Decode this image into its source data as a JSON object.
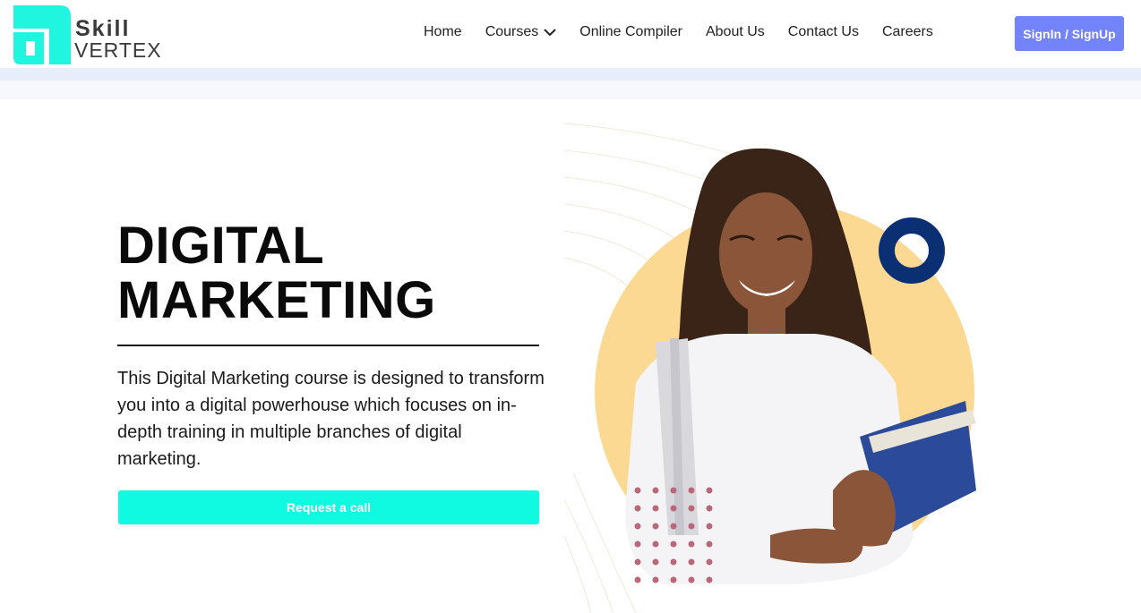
{
  "logo": {
    "line1": "Skill",
    "line2": "VERTEX",
    "mark_color": "#1ff5df"
  },
  "nav": {
    "items": [
      {
        "label": "Home"
      },
      {
        "label": "Courses"
      },
      {
        "label": "Online Compiler"
      },
      {
        "label": "About Us"
      },
      {
        "label": "Contact Us"
      },
      {
        "label": "Careers"
      }
    ],
    "signin_label": "SignIn / SignUp"
  },
  "hero": {
    "title_line1": "DIGITAL",
    "title_line2": "MARKETING",
    "description": "This Digital Marketing course is designed to transform you into a digital powerhouse which focuses on in-depth training in multiple branches of digital marketing.",
    "cta_label": "Request a call"
  },
  "colors": {
    "accent": "#10fae2",
    "signin": "#7383f9",
    "circle": "#fcd993",
    "ring": "#0b2f73",
    "dots": "#b8687a"
  }
}
